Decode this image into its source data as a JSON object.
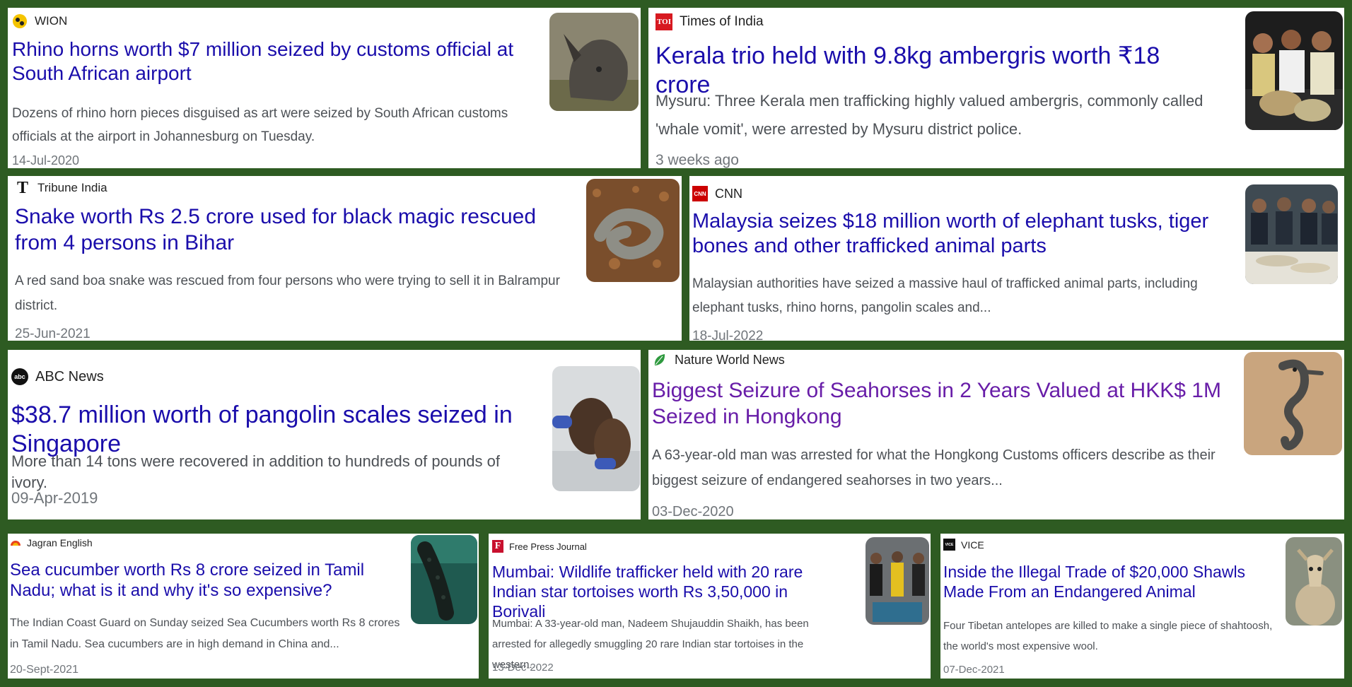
{
  "cards": [
    {
      "source": "WION",
      "title": "Rhino horns worth $7 million seized by customs official at South African airport",
      "description": "Dozens of rhino horn pieces disguised as art were seized by South African customs officials at the airport in Johannesburg on Tuesday.",
      "date": "14-Jul-2020",
      "logo": "wion-logo-icon",
      "thumbnail": "rhino-image"
    },
    {
      "source": "Times of India",
      "title": "Kerala trio held with 9.8kg ambergris worth ₹18 crore",
      "description": "Mysuru: Three Kerala men trafficking highly valued ambergris, commonly called 'whale vomit', were arrested by Mysuru district police.",
      "date": "3 weeks ago",
      "logo": "toi-logo-icon",
      "logo_text": "TOI",
      "thumbnail": "ambergris-arrest-image"
    },
    {
      "source": "Tribune India",
      "title": "Snake worth Rs 2.5 crore used for black magic rescued from 4 persons in Bihar",
      "description": "A red sand boa snake was rescued from four persons who were trying to sell it in Balrampur district.",
      "date": "25-Jun-2021",
      "logo": "tribune-logo-icon",
      "logo_text": "T",
      "thumbnail": "snake-image"
    },
    {
      "source": "CNN",
      "title": "Malaysia seizes $18 million worth of elephant tusks, tiger bones and other trafficked animal parts",
      "description": "Malaysian authorities have seized a massive haul of trafficked animal parts, including elephant tusks, rhino horns, pangolin scales and...",
      "date": "18-Jul-2022",
      "logo": "cnn-logo-icon",
      "logo_text": "CNN",
      "thumbnail": "seizure-officers-image"
    },
    {
      "source": "ABC News",
      "title": "$38.7 million worth of pangolin scales seized in Singapore",
      "description": "More than 14 tons were recovered in addition to hundreds of pounds of ivory.",
      "date": "09-Apr-2019",
      "logo": "abc-logo-icon",
      "logo_text": "abc",
      "thumbnail": "pangolin-scales-image"
    },
    {
      "source": "Nature World News",
      "title": "Biggest Seizure of Seahorses in 2 Years Valued at HKK$ 1M Seized in Hongkong",
      "description": "A 63-year-old man was arrested for what the Hongkong Customs officers describe as their biggest seizure of endangered seahorses in two years...",
      "date": "03-Dec-2020",
      "logo": "leaf-logo-icon",
      "thumbnail": "seahorse-image"
    },
    {
      "source": "Jagran English",
      "title": "Sea cucumber worth Rs 8 crore seized in Tamil Nadu; what is it and why it's so expensive?",
      "description": "The Indian Coast Guard on Sunday seized Sea Cucumbers worth Rs 8 crores in Tamil Nadu. Sea cucumbers are in high demand in China and...",
      "date": "20-Sept-2021",
      "logo": "jagran-logo-icon",
      "thumbnail": "sea-cucumber-image"
    },
    {
      "source": "Free Press Journal",
      "title": "Mumbai: Wildlife trafficker held with 20 rare Indian star tortoises worth Rs 3,50,000 in Borivali",
      "description": "Mumbai: A 33-year-old man, Nadeem Shujauddin Shaikh, has been arrested for allegedly smuggling 20 rare Indian star tortoises in the western...",
      "date": "13-Dec-2022",
      "logo": "fpj-logo-icon",
      "logo_text": "F",
      "thumbnail": "tortoise-arrest-image"
    },
    {
      "source": "VICE",
      "title": "Inside the Illegal Trade of $20,000 Shawls Made From an Endangered Animal",
      "description": "Four Tibetan antelopes are killed to make a single piece of shahtoosh, the world's most expensive wool.",
      "date": "07-Dec-2021",
      "logo": "vice-logo-icon",
      "logo_text": "VICE",
      "thumbnail": "antelope-image"
    }
  ]
}
